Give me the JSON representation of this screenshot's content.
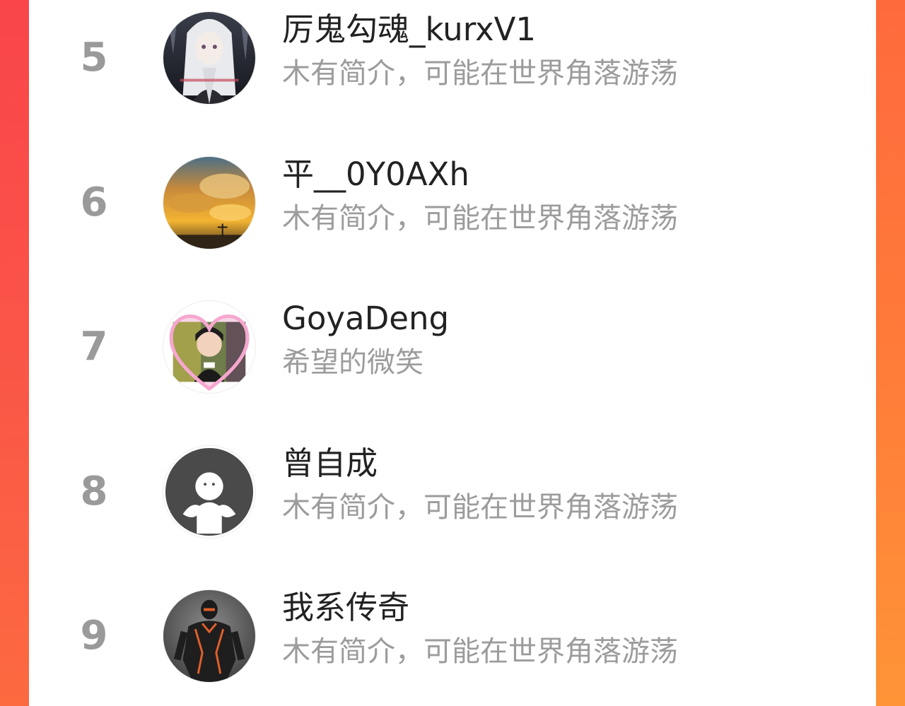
{
  "colors": {
    "accent_left": "#f9454a",
    "accent_right": "#ff7b39",
    "rank": "#9a9a9a",
    "name": "#222222",
    "desc": "#9c9c9c"
  },
  "rows": [
    {
      "rank": "5",
      "name": "厉鬼勾魂_kurxV1",
      "desc": "木有简介，可能在世界角落游荡",
      "avatar": "anime-white-hair-avatar"
    },
    {
      "rank": "6",
      "name": "平__0Y0AXh",
      "desc": "木有简介，可能在世界角落游荡",
      "avatar": "sunset-clouds-avatar"
    },
    {
      "rank": "7",
      "name": "GoyaDeng",
      "desc": "希望的微笑",
      "avatar": "child-heart-frame-avatar"
    },
    {
      "rank": "8",
      "name": "曾自成",
      "desc": "木有简介，可能在世界角落游荡",
      "avatar": "default-user-avatar"
    },
    {
      "rank": "9",
      "name": "我系传奇",
      "desc": "木有简介，可能在世界角落游荡",
      "avatar": "armored-figure-avatar"
    }
  ]
}
